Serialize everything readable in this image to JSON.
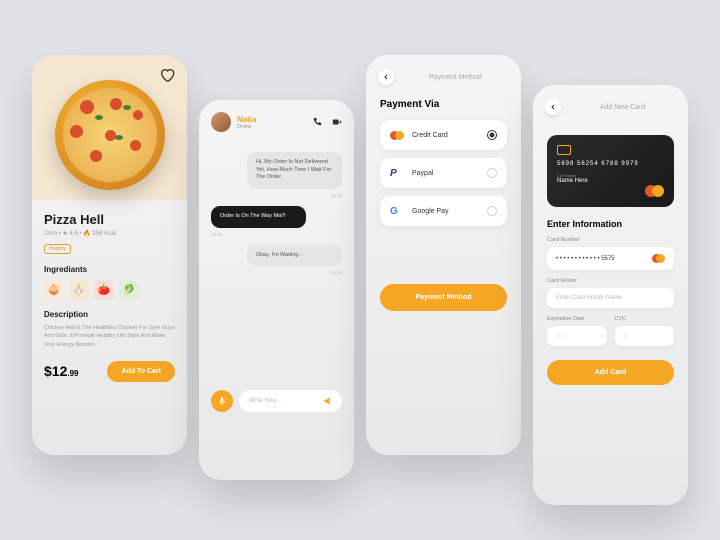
{
  "s1": {
    "title": "Pizza Hell",
    "meta": "2min • ★ 4.5 • 🔥 358 Kcal",
    "tag": "Healthy",
    "ingredients_h": "Ingrediants",
    "description_h": "Description",
    "description": "Chicken Hell Is The Healthies Chicken For Gym Guys And Girls. It Promote Healthy Life Style And Make Your Energy Booster.",
    "price_main": "$12",
    "price_cents": ".99",
    "cta": "Add To Cart"
  },
  "s2": {
    "name": "Natia",
    "status": "Online",
    "msg1": "Hi, My Order Is Not Delivered Yet. How Much Time I Wait For The Order.",
    "ts1": "10:22",
    "msg2": "Order Is On The Way Ma!!!",
    "ts2": "10:22",
    "msg3": "Okay, I'm Waiting...",
    "ts3": "10:23",
    "placeholder": "Write Now..."
  },
  "s3": {
    "header": "Payment Method",
    "title": "Payment Via",
    "opts": [
      {
        "label": "Credit Card"
      },
      {
        "label": "Paypal"
      },
      {
        "label": "Google Pay"
      }
    ],
    "cta": "Payment Method"
  },
  "s4": {
    "header": "Add New Card",
    "card_num": "5698  56254  6788  9979",
    "card_holder_lbl": "Crd Holder",
    "card_name": "Name Here",
    "title": "Enter Information",
    "cardnum_lbl": "Card Number",
    "cardnum_val": "• • • •   • • • •   • • • •   5575",
    "holder_lbl": "Card Holder",
    "holder_ph": "Enter Card Holder Name",
    "exp_lbl": "Expiration Date",
    "exp_val": "○   ○",
    "cvc_lbl": "CVC",
    "cvc_val": "○",
    "cta": "Add Card"
  }
}
